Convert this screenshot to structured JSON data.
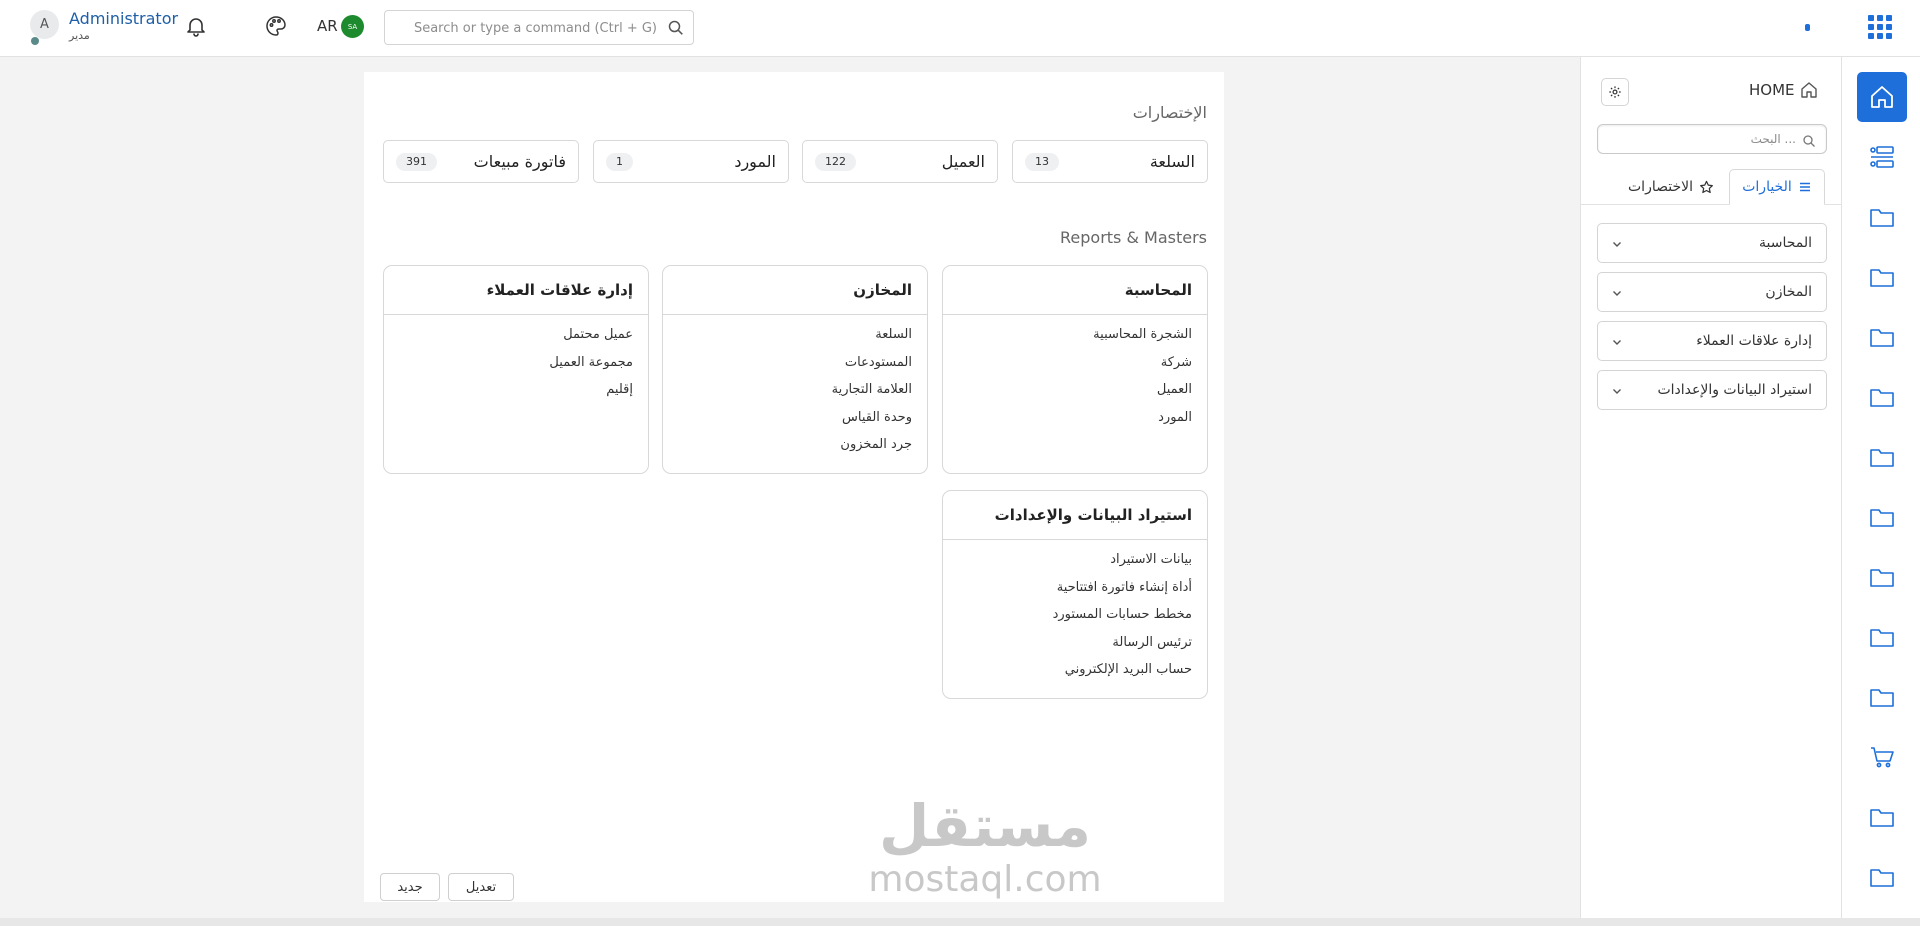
{
  "user": {
    "initial": "A",
    "name": "Administrator",
    "role": "مدير"
  },
  "topbar": {
    "language": "AR",
    "flag_text": "SA",
    "search_placeholder": "Search or type a command (Ctrl + G)",
    "icons": [
      "bell-icon",
      "palette-icon",
      "search-icon",
      "apps-grid-icon"
    ]
  },
  "sidebar": {
    "home_label": "HOME",
    "search_placeholder": "البحث ...",
    "tabs": [
      {
        "label": "الخيارات",
        "active": true,
        "icon": "list-icon"
      },
      {
        "label": "الاختصارات",
        "active": false,
        "icon": "star-icon"
      }
    ],
    "modules": [
      {
        "label": "المحاسبة"
      },
      {
        "label": "المخازن"
      },
      {
        "label": "إدارة علاقات العملاء"
      },
      {
        "label": "استيراد البيانات والإعدادات"
      }
    ]
  },
  "rail_icons": [
    "home-icon",
    "workspaces-icon",
    "folder-icon",
    "folder-icon",
    "folder-icon",
    "folder-icon",
    "folder-icon",
    "folder-icon",
    "folder-icon",
    "folder-icon",
    "folder-icon",
    "cart-icon",
    "folder-icon",
    "folder-icon"
  ],
  "workspace": {
    "shortcuts_title": "الإختصارات",
    "shortcuts": [
      {
        "label": "السلعة",
        "count": "13"
      },
      {
        "label": "العميل",
        "count": "122"
      },
      {
        "label": "المورد",
        "count": "1"
      },
      {
        "label": "فاتورة مبيعات",
        "count": "391"
      }
    ],
    "reports_title": "Reports & Masters",
    "cards": [
      {
        "title": "المحاسبة",
        "items": [
          "الشجرة المحاسبية",
          "شركة",
          "العميل",
          "المورد"
        ]
      },
      {
        "title": "المخازن",
        "items": [
          "السلعة",
          "المستودعات",
          "العلامة التجارية",
          "وحدة القياس",
          "جرد المخزون"
        ]
      },
      {
        "title": "إدارة علاقات العملاء",
        "items": [
          "عميل محتمل",
          "مجموعة العميل",
          "إقليم"
        ]
      },
      {
        "title": "استيراد البيانات والإعدادات",
        "items": [
          "بيانات الاستيراد",
          "أداة إنشاء فاتورة افتتاحية",
          "مخطط حسابات المستورد",
          "ترئيس الرسالة",
          "حساب البريد الإلكتروني"
        ]
      }
    ],
    "edit_label": "تعديل",
    "new_label": "جديد"
  },
  "watermark": {
    "arabic": "مستقل",
    "latin": "mostaql.com"
  }
}
